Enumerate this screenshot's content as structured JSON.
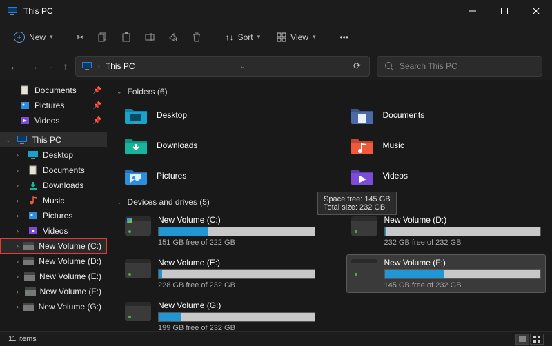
{
  "window": {
    "title": "This PC"
  },
  "toolbar": {
    "new_label": "New",
    "sort_label": "Sort",
    "view_label": "View"
  },
  "nav": {
    "location": "This PC",
    "search_placeholder": "Search This PC"
  },
  "sidebar": {
    "quick": [
      {
        "label": "Documents",
        "pinned": true
      },
      {
        "label": "Pictures",
        "pinned": true
      },
      {
        "label": "Videos",
        "pinned": true
      }
    ],
    "thispc": {
      "label": "This PC"
    },
    "thispc_children": [
      {
        "label": "Desktop"
      },
      {
        "label": "Documents"
      },
      {
        "label": "Downloads"
      },
      {
        "label": "Music"
      },
      {
        "label": "Pictures"
      },
      {
        "label": "Videos"
      },
      {
        "label": "New Volume (C:)",
        "highlighted": true
      },
      {
        "label": "New Volume (D:)"
      },
      {
        "label": "New Volume (E:)"
      },
      {
        "label": "New Volume (F:)"
      },
      {
        "label": "New Volume (G:)"
      }
    ]
  },
  "folders_header": "Folders (6)",
  "folders": [
    {
      "label": "Desktop",
      "color": "#1aa3c9"
    },
    {
      "label": "Documents",
      "color": "#4a6aa8"
    },
    {
      "label": "Downloads",
      "color": "#17b39b"
    },
    {
      "label": "Music",
      "color": "#ef5a3c"
    },
    {
      "label": "Pictures",
      "color": "#2f8de0"
    },
    {
      "label": "Videos",
      "color": "#7a4cd8"
    }
  ],
  "drives_header": "Devices and drives (5)",
  "drives": [
    {
      "name": "New Volume (C:)",
      "free": "151 GB free of 222 GB",
      "used_pct": 32,
      "os": true
    },
    {
      "name": "New Volume (D:)",
      "free": "232 GB free of 232 GB",
      "used_pct": 1
    },
    {
      "name": "New Volume (E:)",
      "free": "228 GB free of 232 GB",
      "used_pct": 2
    },
    {
      "name": "New Volume (F:)",
      "free": "145 GB free of 232 GB",
      "used_pct": 38,
      "selected": true
    },
    {
      "name": "New Volume (G:)",
      "free": "199 GB free of 232 GB",
      "used_pct": 14
    }
  ],
  "tooltip": {
    "line1": "Space free: 145 GB",
    "line2": "Total size: 232 GB"
  },
  "status": {
    "items": "11 items"
  }
}
